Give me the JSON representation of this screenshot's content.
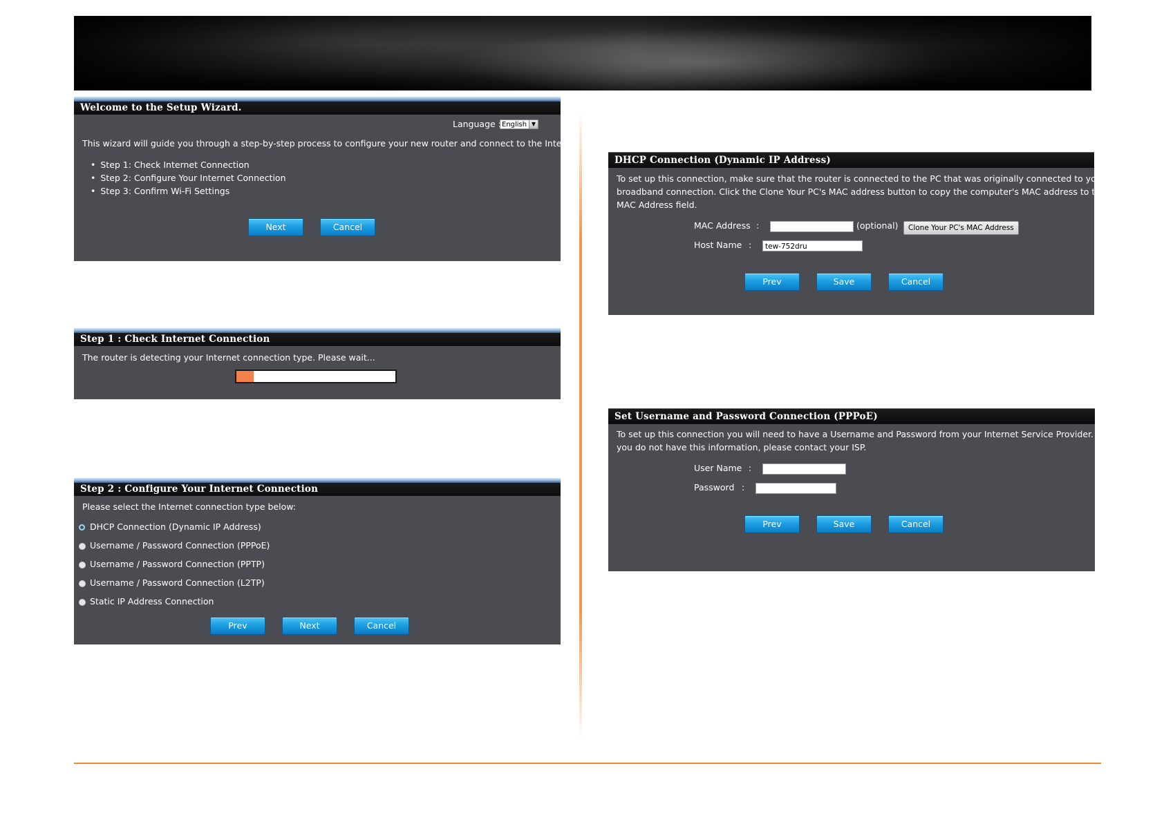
{
  "wizard": {
    "title": "Welcome to the Setup Wizard.",
    "language_label": "Language :",
    "language_value": "English",
    "intro": "This wizard will guide you through a step-by-step process to configure your new router and connect to the Internet.",
    "steps": [
      "Step 1: Check Internet Connection",
      "Step 2: Configure Your Internet Connection",
      "Step 3: Confirm Wi-Fi Settings"
    ],
    "next_label": "Next",
    "cancel_label": "Cancel"
  },
  "step1": {
    "title": "Step 1 : Check Internet Connection",
    "message": "The router is detecting your Internet connection type. Please wait...",
    "progress": 0.11
  },
  "step2": {
    "title": "Step 2 : Configure Your Internet Connection",
    "prompt": "Please select the Internet connection type below:",
    "options": [
      "DHCP Connection (Dynamic IP Address)",
      "Username / Password Connection (PPPoE)",
      "Username / Password Connection (PPTP)",
      "Username / Password Connection (L2TP)",
      "Static IP Address Connection"
    ],
    "selected_index": 0,
    "prev_label": "Prev",
    "next_label": "Next",
    "cancel_label": "Cancel"
  },
  "dhcp": {
    "title": "DHCP Connection (Dynamic IP Address)",
    "desc_lines": [
      "To set up this connection, make sure that the router is connected to the PC that was originally connected to your",
      "broadband connection. Click the Clone Your PC's MAC address button to copy the computer's MAC address to the",
      "MAC Address field."
    ],
    "mac_label": "MAC Address",
    "colon": ":",
    "mac_value": "",
    "optional": "(optional)",
    "clone_label": "Clone Your PC's MAC Address",
    "host_label": "Host Name",
    "host_value": "tew-752dru",
    "prev_label": "Prev",
    "save_label": "Save",
    "cancel_label": "Cancel"
  },
  "pppoe": {
    "title": "Set Username and Password Connection (PPPoE)",
    "desc_lines": [
      "To set up this connection you will need to have a Username and Password from your Internet Service Provider. If",
      "you do not have this information, please contact your ISP."
    ],
    "user_label": "User Name",
    "pass_label": "Password",
    "colon": ":",
    "user_value": "",
    "pass_value": "",
    "prev_label": "Prev",
    "save_label": "Save",
    "cancel_label": "Cancel"
  },
  "colors": {
    "panel_bg": "#4b4c51",
    "header_bg": "#111111",
    "button_blue": "#1a9be0",
    "accent_orange": "#e88a2e",
    "progress_fill": "#f2814a"
  }
}
